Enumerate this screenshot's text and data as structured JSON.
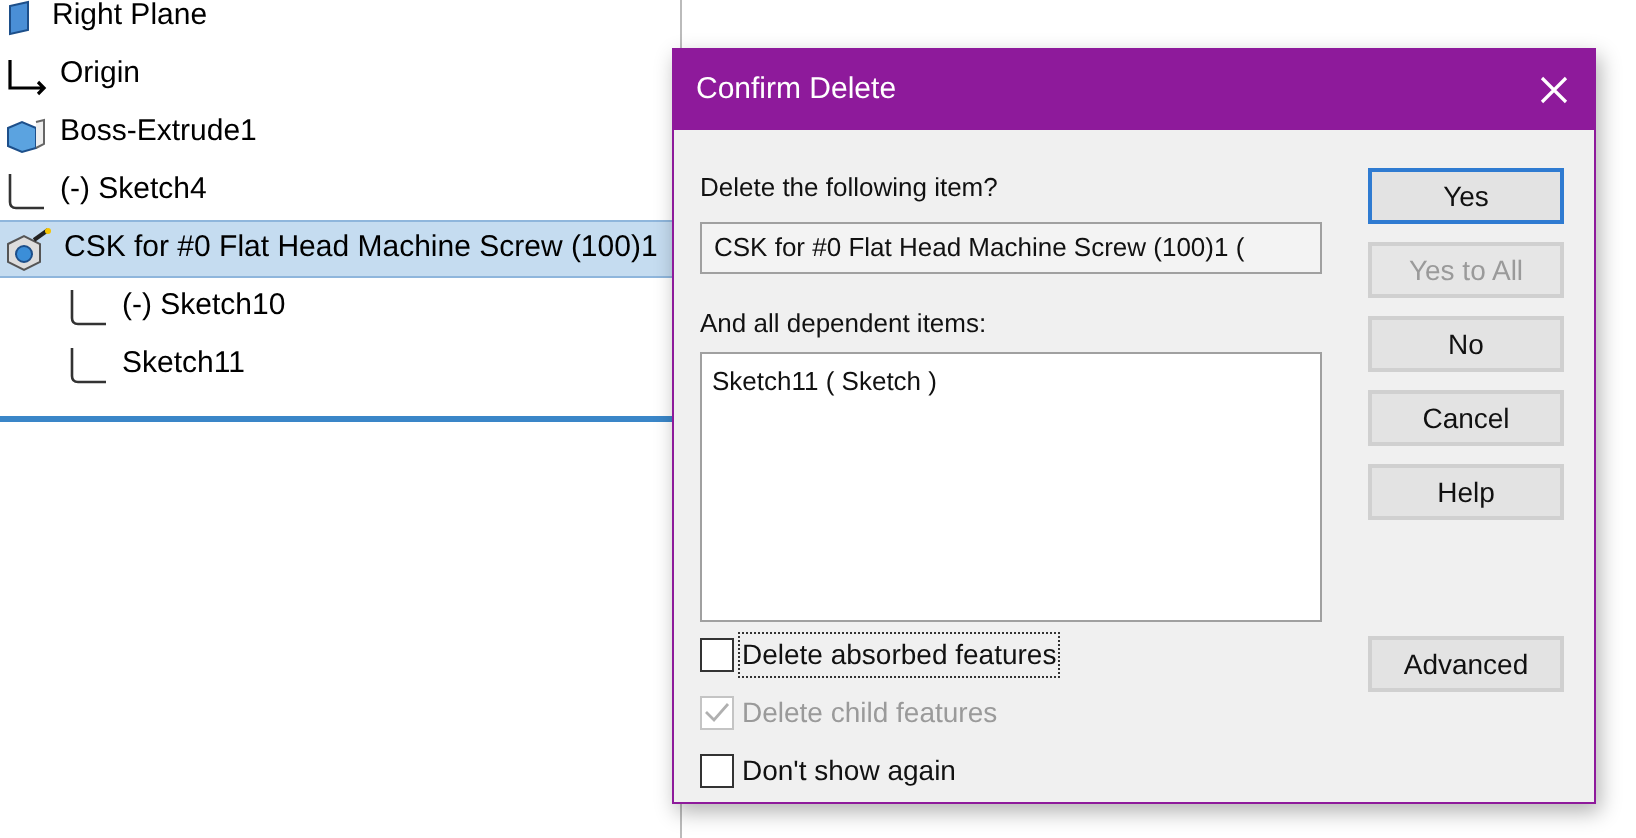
{
  "tree": {
    "items": [
      {
        "kind": "plane",
        "label": "Right Plane",
        "selected": false
      },
      {
        "kind": "origin",
        "label": "Origin",
        "selected": false
      },
      {
        "kind": "extrude",
        "label": "Boss-Extrude1",
        "selected": false
      },
      {
        "kind": "sketch",
        "label": "(-) Sketch4",
        "selected": false
      },
      {
        "kind": "hole",
        "label": "CSK for #0 Flat Head Machine Screw (100)1",
        "selected": true,
        "children": [
          {
            "kind": "sketch",
            "label": "(-) Sketch10",
            "selected": false
          },
          {
            "kind": "sketch",
            "label": "Sketch11",
            "selected": false
          }
        ]
      }
    ]
  },
  "dialog": {
    "title": "Confirm Delete",
    "prompt": "Delete the following item?",
    "item_value": "CSK for #0 Flat Head Machine Screw (100)1 (",
    "dependents_label": "And all dependent items:",
    "dependents": [
      "Sketch11 ( Sketch )"
    ],
    "checkboxes": [
      {
        "label": "Delete absorbed features",
        "checked": false,
        "disabled": false,
        "focused": true
      },
      {
        "label": "Delete child features",
        "checked": true,
        "disabled": true,
        "focused": false
      },
      {
        "label": "Don't show again",
        "checked": false,
        "disabled": false,
        "focused": false
      }
    ],
    "buttons": [
      {
        "label": "Yes",
        "disabled": false,
        "default": true
      },
      {
        "label": "Yes to All",
        "disabled": true,
        "default": false
      },
      {
        "label": "No",
        "disabled": false,
        "default": false
      },
      {
        "label": "Cancel",
        "disabled": false,
        "default": false
      },
      {
        "label": "Help",
        "disabled": false,
        "default": false
      }
    ],
    "advanced_button": "Advanced"
  }
}
